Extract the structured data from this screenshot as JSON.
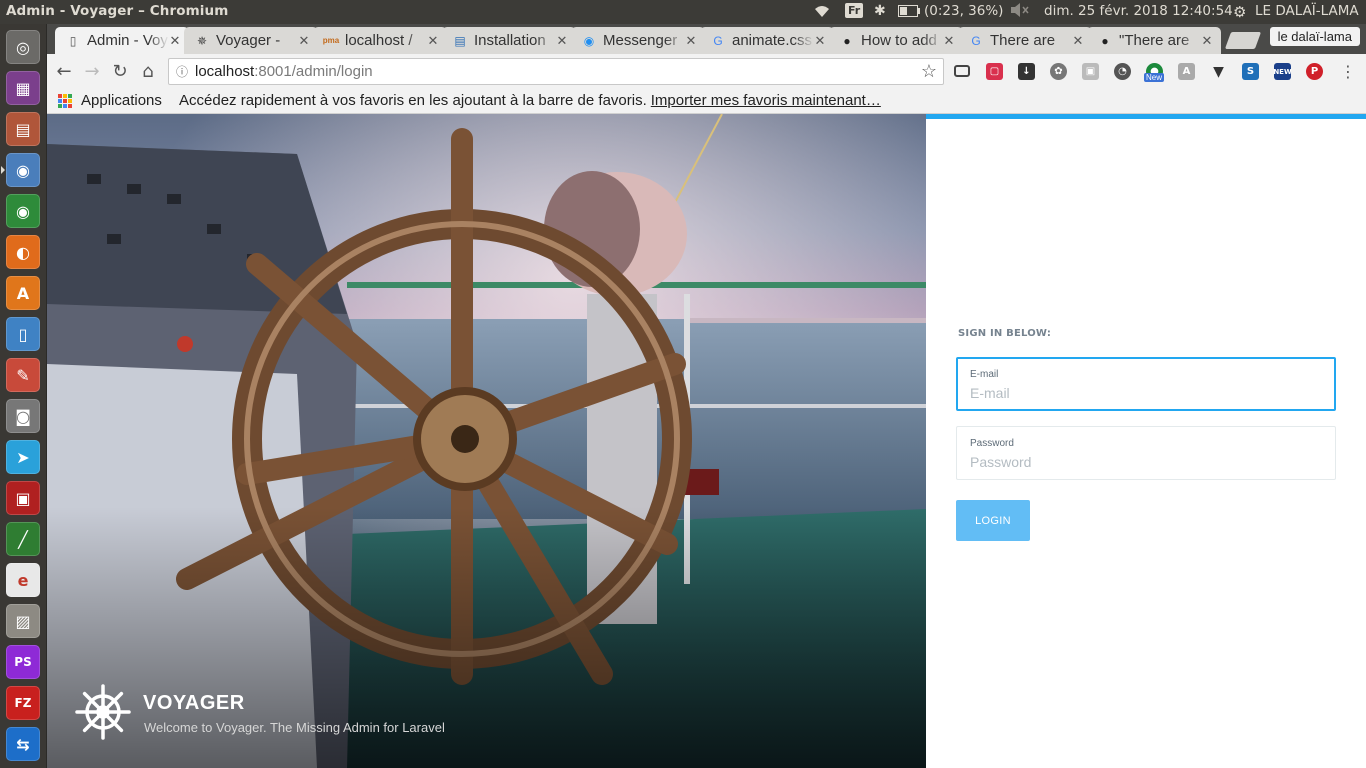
{
  "system_panel": {
    "window_title": "Admin - Voyager – Chromium",
    "keyboard_layout": "Fr",
    "battery": "(0:23, 36%)",
    "datetime": "dim. 25 févr. 2018 12:40:54",
    "username": "LE DALAÏ-LAMA"
  },
  "launcher": {
    "items": [
      {
        "name": "ubuntu-dash",
        "color": "#6b6a67",
        "glyph": "◎"
      },
      {
        "name": "video-app",
        "color": "#7b3f8c",
        "glyph": "▦"
      },
      {
        "name": "files",
        "color": "#b0563a",
        "glyph": "▤"
      },
      {
        "name": "chromium",
        "color": "#4a7ebb",
        "glyph": "◉"
      },
      {
        "name": "chrome",
        "color": "#2e8b3a",
        "glyph": "◉"
      },
      {
        "name": "firefox",
        "color": "#e06b1b",
        "glyph": "◐"
      },
      {
        "name": "software-center",
        "color": "#e0761b",
        "glyph": "A"
      },
      {
        "name": "libreoffice-writer",
        "color": "#3f82c4",
        "glyph": "▯"
      },
      {
        "name": "system-settings",
        "color": "#c84a3a",
        "glyph": "✎"
      },
      {
        "name": "screenshot",
        "color": "#777",
        "glyph": "◙"
      },
      {
        "name": "telegram",
        "color": "#2aa1da",
        "glyph": "➤"
      },
      {
        "name": "app-red",
        "color": "#b02020",
        "glyph": "▣"
      },
      {
        "name": "color-picker",
        "color": "#2f7d32",
        "glyph": "╱"
      },
      {
        "name": "document-viewer",
        "color": "#e8e8e8",
        "glyph": "e"
      },
      {
        "name": "image-viewer",
        "color": "#8d8a83",
        "glyph": "▨"
      },
      {
        "name": "phpstorm",
        "color": "#8e2ad6",
        "glyph": "PS"
      },
      {
        "name": "filezilla",
        "color": "#c8201e",
        "glyph": "FZ"
      },
      {
        "name": "teamviewer",
        "color": "#1d6ec9",
        "glyph": "⇆"
      }
    ]
  },
  "tabs": [
    {
      "title": "Admin - Voyager",
      "favicon": "page-icon",
      "active": true
    },
    {
      "title": "Voyager - ",
      "favicon": "voyager-helm-icon",
      "active": false
    },
    {
      "title": "localhost / ",
      "favicon": "phpmyadmin-icon",
      "active": false
    },
    {
      "title": "Installation",
      "favicon": "doc-book-icon",
      "active": false
    },
    {
      "title": "Messenger",
      "favicon": "messenger-icon",
      "active": false
    },
    {
      "title": "animate.css",
      "favicon": "google-icon",
      "active": false
    },
    {
      "title": "How to add",
      "favicon": "github-icon",
      "active": false
    },
    {
      "title": "There are",
      "favicon": "google-icon",
      "active": false
    },
    {
      "title": "\"There are",
      "favicon": "github-icon",
      "active": false
    }
  ],
  "profile_name": "le dalaï-lama",
  "address_bar": {
    "host": "localhost",
    "rest": ":8001/admin/login"
  },
  "bookmarks": {
    "apps_label": "Applications",
    "hint": "Accédez rapidement à vos favoris en les ajoutant à la barre de favoris.",
    "import_link": "Importer mes favoris maintenant…"
  },
  "extensions": {
    "new_badge": "New"
  },
  "hero": {
    "brand_title": "VOYAGER",
    "brand_subtitle": "Welcome to Voyager. The Missing Admin for Laravel"
  },
  "login_form": {
    "heading": "SIGN IN BELOW:",
    "email_label": "E-mail",
    "email_placeholder": "E-mail",
    "email_value": "",
    "password_label": "Password",
    "password_placeholder": "Password",
    "password_value": "",
    "login_button": "LOGIN",
    "accent_color": "#22a7f0"
  }
}
